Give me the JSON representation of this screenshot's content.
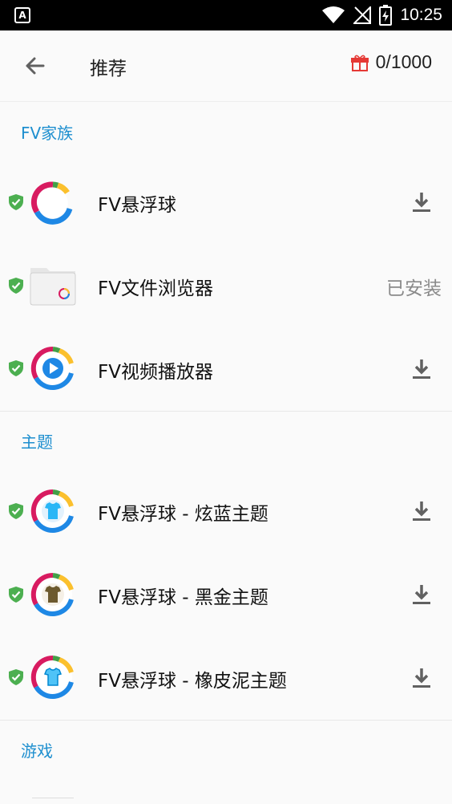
{
  "status_bar": {
    "time": "10:25",
    "notification_icon": "a-icon"
  },
  "app_bar": {
    "title": "推荐",
    "points": "0/1000"
  },
  "sections": [
    {
      "title": "FV家族",
      "items": [
        {
          "name": "FV悬浮球",
          "status": "download"
        },
        {
          "name": "FV文件浏览器",
          "status": "已安装"
        },
        {
          "name": "FV视频播放器",
          "status": "download"
        }
      ]
    },
    {
      "title": "主题",
      "items": [
        {
          "name": "FV悬浮球 - 炫蓝主题",
          "status": "download"
        },
        {
          "name": "FV悬浮球 - 黑金主题",
          "status": "download"
        },
        {
          "name": "FV悬浮球 - 橡皮泥主题",
          "status": "download"
        }
      ]
    },
    {
      "title": "游戏",
      "items": []
    }
  ],
  "colors": {
    "accent": "#1e8fcf",
    "shield": "#4caf50",
    "ring_red": "#d81b60",
    "ring_blue": "#1e88e5",
    "ring_yellow": "#fbc02d",
    "ring_green": "#43a047"
  }
}
